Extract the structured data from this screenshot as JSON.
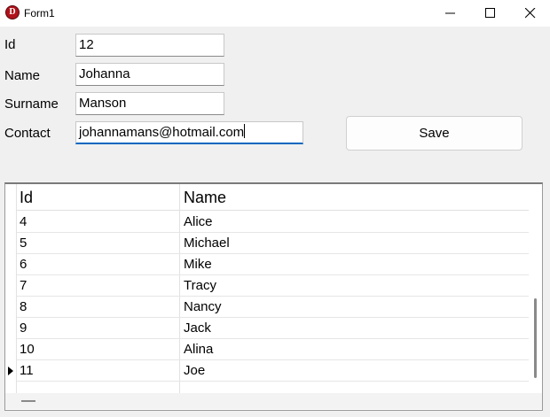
{
  "window": {
    "title": "Form1",
    "icon_letter": "D",
    "accent_color": "#b0121b"
  },
  "form": {
    "id_label": "Id",
    "id_value": "12",
    "name_label": "Name",
    "name_value": "Johanna",
    "surname_label": "Surname",
    "surname_value": "Manson",
    "contact_label": "Contact",
    "contact_value": "johannamans@hotmail.com",
    "save_label": "Save"
  },
  "grid": {
    "columns": [
      "Id",
      "Name"
    ],
    "rows": [
      {
        "id": "4",
        "name": "Alice"
      },
      {
        "id": "5",
        "name": "Michael"
      },
      {
        "id": "6",
        "name": "Mike"
      },
      {
        "id": "7",
        "name": "Tracy"
      },
      {
        "id": "8",
        "name": "Nancy"
      },
      {
        "id": "9",
        "name": "Jack"
      },
      {
        "id": "10",
        "name": "Alina"
      },
      {
        "id": "11",
        "name": "Joe"
      }
    ],
    "current_row_index": 7
  }
}
